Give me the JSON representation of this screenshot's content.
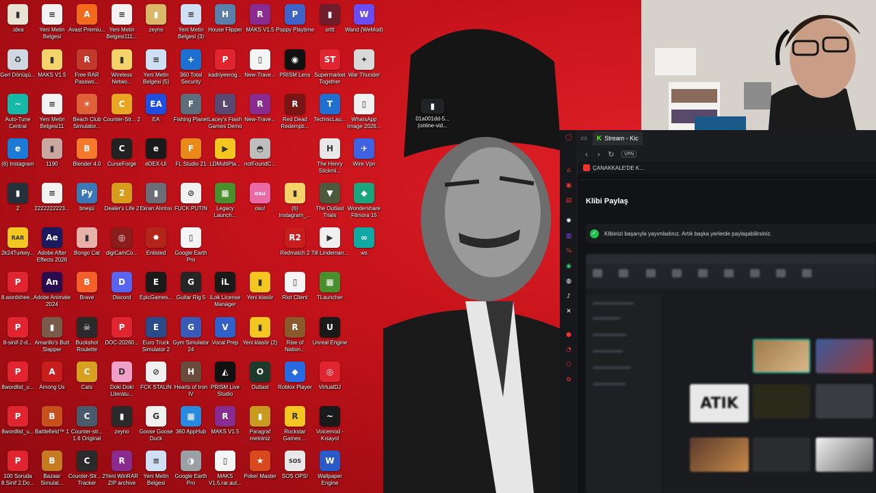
{
  "desktop": {
    "icons": [
      {
        "label": ".idea",
        "glyph": "▮",
        "color": "#e8e3d3"
      },
      {
        "label": "Yeni Metin Belgesi",
        "glyph": "≡",
        "color": "#f2f2f2"
      },
      {
        "label": "Avast Premiu...",
        "glyph": "A",
        "color": "#f26b1d"
      },
      {
        "label": "Yeni Metin Belgesi111...",
        "glyph": "≡",
        "color": "#f2f2f2"
      },
      {
        "label": "zeyno",
        "glyph": "▮",
        "color": "#d9b86a"
      },
      {
        "label": "Yeni Metin Belgesi (3)",
        "glyph": "≡",
        "color": "#cfe0f5"
      },
      {
        "label": "House Flipper",
        "glyph": "H",
        "color": "#5a7fa8"
      },
      {
        "label": "MAKS V1.5",
        "glyph": "R",
        "color": "#8a2b8f"
      },
      {
        "label": "Poppy Playtime",
        "glyph": "P",
        "color": "#3f63c7"
      },
      {
        "label": "srttt",
        "glyph": "▮",
        "color": "#6f1d2a"
      },
      {
        "label": "Wand (WeMod)",
        "glyph": "W",
        "color": "#6b4cf0"
      },
      {
        "label": "Geri Dönüşü...",
        "glyph": "♻",
        "color": "#cfd8e0"
      },
      {
        "label": "MAKS V1.5",
        "glyph": "▮",
        "color": "#f4d36b"
      },
      {
        "label": "Free RAR Passwo...",
        "glyph": "R",
        "color": "#c0392b"
      },
      {
        "label": "Wireless Netwo...",
        "glyph": "▮",
        "color": "#f4d36b"
      },
      {
        "label": "Yeni Metin Belgesi (5)",
        "glyph": "≡",
        "color": "#cfe0f5"
      },
      {
        "label": "360 Total Security",
        "glyph": "+",
        "color": "#1d6fd0"
      },
      {
        "label": "kadriyeerog...",
        "glyph": "P",
        "color": "#e02430"
      },
      {
        "label": "New-Trave...",
        "glyph": "▯",
        "color": "#f5f5f5"
      },
      {
        "label": "PRISM Lens",
        "glyph": "◉",
        "color": "#111111"
      },
      {
        "label": "Supermarket Together",
        "glyph": "ST",
        "color": "#e02430"
      },
      {
        "label": "War Thunder",
        "glyph": "✦",
        "color": "#d9d9d9"
      },
      {
        "label": "Auto-Tune Central",
        "glyph": "~",
        "color": "#16b8a7"
      },
      {
        "label": "Yeni Metin Belgesi11",
        "glyph": "≡",
        "color": "#f2f2f2"
      },
      {
        "label": "Beach Club Simulator...",
        "glyph": "☀",
        "color": "#e0603a"
      },
      {
        "label": "Counter-Str... 2",
        "glyph": "C",
        "color": "#e8a623"
      },
      {
        "label": "EA",
        "glyph": "EA",
        "color": "#1f4fe0"
      },
      {
        "label": "Fishing Planet",
        "glyph": "F",
        "color": "#5e6d7a"
      },
      {
        "label": "Lacey's Flash Games Demo",
        "glyph": "L",
        "color": "#5a4870"
      },
      {
        "label": "New-Trave...",
        "glyph": "R",
        "color": "#8a2b8f"
      },
      {
        "label": "Red Dead Redempti...",
        "glyph": "R",
        "color": "#7a1515"
      },
      {
        "label": "TechnicLau...",
        "glyph": "T",
        "color": "#1f6fd0"
      },
      {
        "label": "WhatsApp Image 2026...",
        "glyph": "▯",
        "color": "#f0f0f0"
      },
      {
        "label": "(6) Instagram",
        "glyph": "e",
        "color": "#1b7bd6"
      },
      {
        "label": "1190",
        "glyph": "▮",
        "color": "#c9a6a0"
      },
      {
        "label": "Blender 4.0",
        "glyph": "B",
        "color": "#f5792a"
      },
      {
        "label": "CurseForge",
        "glyph": "C",
        "color": "#222222"
      },
      {
        "label": "eDEX-UI",
        "glyph": "e",
        "color": "#1a1a1a"
      },
      {
        "label": "FL Studio 21",
        "glyph": "F",
        "color": "#e8891a"
      },
      {
        "label": "LDMultiPla...",
        "glyph": "▶",
        "color": "#f4c621"
      },
      {
        "label": "notFoundC...",
        "glyph": "◓",
        "color": "#bdbdbd"
      },
      {
        "label": "The Henry Stickmi...",
        "glyph": "H",
        "color": "#e8e8e8"
      },
      {
        "label": "Wire Vpn",
        "glyph": "✈",
        "color": "#3f63e0"
      },
      {
        "label": "2",
        "glyph": "▮",
        "color": "#24303a"
      },
      {
        "label": "2222222223...",
        "glyph": "≡",
        "color": "#f2f2f2"
      },
      {
        "label": "bneşü",
        "glyph": "Py",
        "color": "#3b78b5"
      },
      {
        "label": "Dealer's Life 2",
        "glyph": "2",
        "color": "#d89c1d"
      },
      {
        "label": "Ekran Alıntısı",
        "glyph": "▮",
        "color": "#6d6d78"
      },
      {
        "label": "FUCK PUTIN",
        "glyph": "⊘",
        "color": "#f0f0f0"
      },
      {
        "label": "Legacy Launch...",
        "glyph": "▦",
        "color": "#4a8f2e"
      },
      {
        "label": "osu!",
        "glyph": "osu",
        "color": "#ea6aa6"
      },
      {
        "label": "(6) Instagram_...",
        "glyph": "▮",
        "color": "#f4d36b"
      },
      {
        "label": "The Outlast Trials",
        "glyph": "▼",
        "color": "#4b5a3a"
      },
      {
        "label": "Wondershare Filmora 15",
        "glyph": "◆",
        "color": "#1aa57f"
      },
      {
        "label": "2k24Turkey...",
        "glyph": "RAR",
        "color": "#f4c621"
      },
      {
        "label": "Adobe After Effects 2026",
        "glyph": "Ae",
        "color": "#1c1a5e"
      },
      {
        "label": "Bongo Cat",
        "glyph": "▮",
        "color": "#e8b0a8"
      },
      {
        "label": "digiCamCo...",
        "glyph": "◎",
        "color": "#8c1d1d"
      },
      {
        "label": "Enlisted",
        "glyph": "✸",
        "color": "#b3241b"
      },
      {
        "label": "Google Earth Pro",
        "glyph": "▯",
        "color": "#f5f5f5"
      },
      {
        "label": "Redmatch 2",
        "glyph": "R2",
        "color": "#c81d1d"
      },
      {
        "label": "Till Lindeman...",
        "glyph": "▶",
        "color": "#f0f0f0"
      },
      {
        "label": "ws",
        "glyph": "∞",
        "color": "#11a9a3"
      },
      {
        "label": "8.wordshee...",
        "glyph": "P",
        "color": "#e02430"
      },
      {
        "label": "Adobe Animate 2024",
        "glyph": "An",
        "color": "#2a0b4d"
      },
      {
        "label": "Brave",
        "glyph": "B",
        "color": "#f4602a"
      },
      {
        "label": "Discord",
        "glyph": "D",
        "color": "#5865f2"
      },
      {
        "label": "EpicGames...",
        "glyph": "E",
        "color": "#1a1a1a"
      },
      {
        "label": "Guitar Rig 5",
        "glyph": "G",
        "color": "#262626"
      },
      {
        "label": "iLok License Manager",
        "glyph": "iL",
        "color": "#1a1a1a"
      },
      {
        "label": "Yeni klasör",
        "glyph": "▮",
        "color": "#f4c621"
      },
      {
        "label": "Riot Client",
        "glyph": "▯",
        "color": "#f5f5f5"
      },
      {
        "label": "TLauncher",
        "glyph": "▦",
        "color": "#4a8f2e"
      },
      {
        "label": "8-sinif-2-d...",
        "glyph": "P",
        "color": "#e02430"
      },
      {
        "label": "Amarillo's Butt Slapper",
        "glyph": "▮",
        "color": "#7a5a4a"
      },
      {
        "label": "Buckshot Roulette",
        "glyph": "☠",
        "color": "#2a2a2a"
      },
      {
        "label": "DOC-20260...",
        "glyph": "P",
        "color": "#e02430"
      },
      {
        "label": "Euro Truck Simulator 2",
        "glyph": "E",
        "color": "#2a4a8a"
      },
      {
        "label": "Gym Simulator 24",
        "glyph": "G",
        "color": "#3a5ab8"
      },
      {
        "label": "Vocal Prep",
        "glyph": "V",
        "color": "#3060c8"
      },
      {
        "label": "Yeni klasör (2)",
        "glyph": "▮",
        "color": "#f4c621"
      },
      {
        "label": "Rise of Nation...",
        "glyph": "R",
        "color": "#8a5a2a"
      },
      {
        "label": "Unreal Engine",
        "glyph": "U",
        "color": "#1a1a1a"
      },
      {
        "label": "8wordlist_u...",
        "glyph": "P",
        "color": "#e02430"
      },
      {
        "label": "Among Us",
        "glyph": "A",
        "color": "#c81d1d"
      },
      {
        "label": "Cats",
        "glyph": "C",
        "color": "#d8a020"
      },
      {
        "label": "Doki Doki Literatu...",
        "glyph": "D",
        "color": "#f0a0c8"
      },
      {
        "label": "FCK STALIN",
        "glyph": "⊘",
        "color": "#f0f0f0"
      },
      {
        "label": "Hearts of Iron IV",
        "glyph": "H",
        "color": "#6a4a3a"
      },
      {
        "label": "PRISM Live Studio",
        "glyph": "◭",
        "color": "#111111"
      },
      {
        "label": "Outlast",
        "glyph": "O",
        "color": "#1e3a2a"
      },
      {
        "label": "Roblox Player",
        "glyph": "◆",
        "color": "#2a6ae0"
      },
      {
        "label": "VirtualDJ",
        "glyph": "◎",
        "color": "#e02430"
      },
      {
        "label": "8wordlist_u...",
        "glyph": "P",
        "color": "#e02430"
      },
      {
        "label": "Battlefield™ 1",
        "glyph": "B",
        "color": "#c8501d"
      },
      {
        "label": "Counter-str... 1.6 Original",
        "glyph": "C",
        "color": "#4a5a6a"
      },
      {
        "label": "zeyno",
        "glyph": "▮",
        "color": "#2a2a2a"
      },
      {
        "label": "Goose Goose Duck",
        "glyph": "G",
        "color": "#f0f0f0"
      },
      {
        "label": "360 AppHub",
        "glyph": "▦",
        "color": "#2a8ae0"
      },
      {
        "label": "MAKS V1.5",
        "glyph": "R",
        "color": "#8a2b8f"
      },
      {
        "label": "Paragraf metniniz",
        "glyph": "▮",
        "color": "#c89a20"
      },
      {
        "label": "Rockstar Games ...",
        "glyph": "R",
        "color": "#f4c621"
      },
      {
        "label": "Voicemod - Kısayol",
        "glyph": "~",
        "color": "#1a1a1a"
      },
      {
        "label": "100 Soruda 8.Sinif 2.Do...",
        "glyph": "P",
        "color": "#e02430"
      },
      {
        "label": "Bazaar Simulat...",
        "glyph": "B",
        "color": "#c87a20"
      },
      {
        "label": "Counter-Str... 2 Tracker",
        "glyph": "C",
        "color": "#2a2a2a"
      },
      {
        "label": "Yeni WinRAR ZIP archive",
        "glyph": "R",
        "color": "#8a2b8f"
      },
      {
        "label": "Yeni Metin Belgesi",
        "glyph": "≡",
        "color": "#cfe0f5"
      },
      {
        "label": "Google Earth Pro",
        "glyph": "◑",
        "color": "#9aa0a6"
      },
      {
        "label": "MAKS V1.5.rar.aut...",
        "glyph": "▯",
        "color": "#f5f5f5"
      },
      {
        "label": "Poker Master",
        "glyph": "★",
        "color": "#d84a1d"
      },
      {
        "label": "SOS OPS!",
        "glyph": "SOS",
        "color": "#e8e8e8"
      },
      {
        "label": "Wallpaper Engine",
        "glyph": "W",
        "color": "#2a5ac8"
      },
      {
        "label": "01a001dd-5... (online-vid...",
        "glyph": "▮",
        "color": "#202428"
      }
    ]
  },
  "browser": {
    "tab_label": "Stream - Kic",
    "tab_glyph": "K",
    "vpn_label": "VPN",
    "bookmark_label": "ÇANAKKALE'DE K..."
  },
  "share_panel": {
    "title": "Klibi Paylaş",
    "success_message": "Klibinizi başarıyla yayımladınız. Artık başka yerlerde paylaşabilirsiniz.",
    "preview_thumb_text": "ATIK"
  },
  "colors": {
    "accent": "#53fc18",
    "success": "#1fbf4c",
    "wallpaper_red": "#c4121a"
  }
}
